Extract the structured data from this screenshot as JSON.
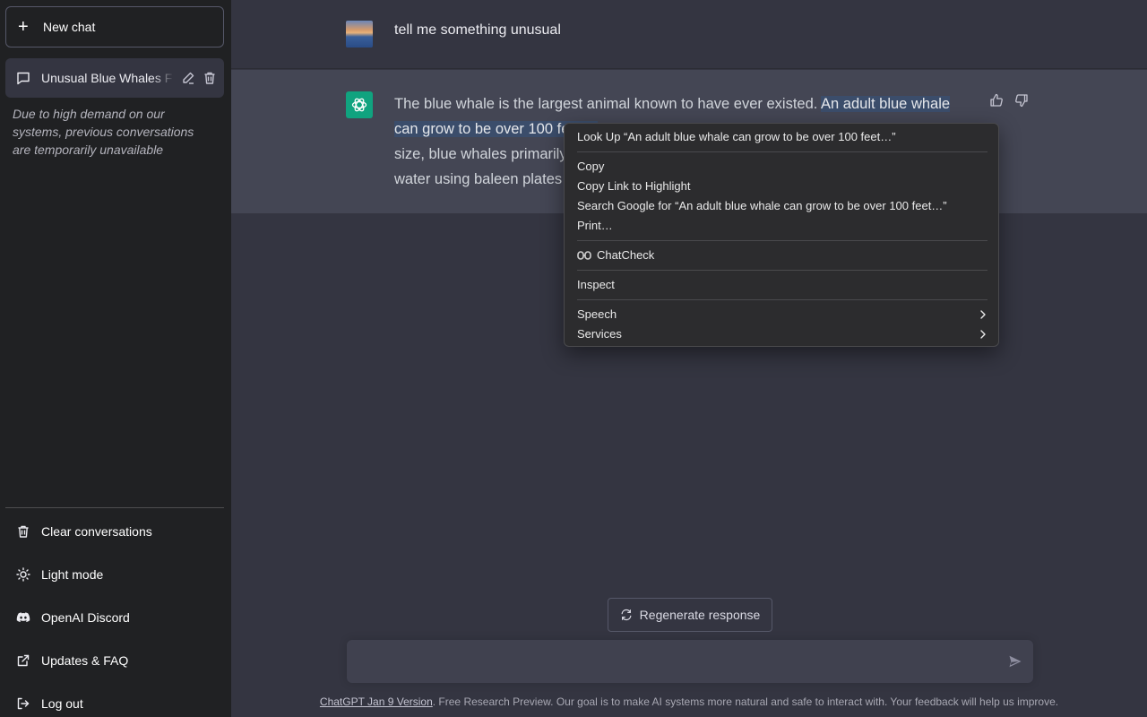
{
  "sidebar": {
    "new_chat_label": "New chat",
    "conversation_title": "Unusual Blue Whales F",
    "notice": "Due to high demand on our systems, previous conversations are temporarily unavailable",
    "links": [
      {
        "label": "Clear conversations",
        "icon": "trash-icon"
      },
      {
        "label": "Light mode",
        "icon": "sun-icon"
      },
      {
        "label": "OpenAI Discord",
        "icon": "discord-icon"
      },
      {
        "label": "Updates & FAQ",
        "icon": "external-link-icon"
      },
      {
        "label": "Log out",
        "icon": "logout-icon"
      }
    ]
  },
  "chat": {
    "user_message": "tell me something unusual",
    "assistant_message": {
      "before_selection": "The blue whale is the largest animal known to have ever existed. ",
      "selection": "An adult blue whale can grow to be over 100 feet lo",
      "line3": "size, blue whales primarily",
      "line4": "water using baleen plates"
    },
    "regenerate_label": "Regenerate response",
    "input_placeholder": ""
  },
  "footer": {
    "version_link": "ChatGPT Jan 9 Version",
    "text": ". Free Research Preview. Our goal is to make AI systems more natural and safe to interact with. Your feedback will help us improve."
  },
  "context_menu": {
    "look_up": "Look Up “An adult blue whale can grow to be over 100 feet…”",
    "copy": "Copy",
    "copy_link": "Copy Link to Highlight",
    "search_google": "Search Google for “An adult blue whale can grow to be over 100 feet…”",
    "print": "Print…",
    "chatcheck": "ChatCheck",
    "inspect": "Inspect",
    "speech": "Speech",
    "services": "Services"
  },
  "colors": {
    "sidebar_bg": "#202123",
    "main_bg": "#343541",
    "assistant_row_bg": "#444654",
    "accent": "#10a37f",
    "selection": "#3b4d6b"
  }
}
